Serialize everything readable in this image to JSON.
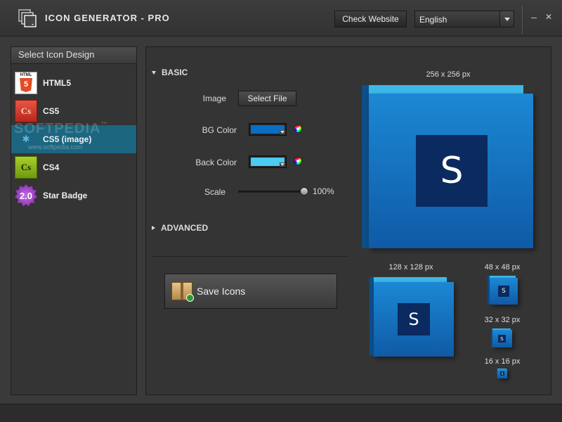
{
  "app": {
    "title": "ICON GENERATOR - PRO",
    "check_website_label": "Check Website",
    "language": "English",
    "minimize_glyph": "–",
    "close_glyph": "✕"
  },
  "sidebar": {
    "header": "Select Icon Design",
    "selected_index": 2,
    "items": [
      {
        "label": "HTML5",
        "icon": "html5-icon",
        "icon_text": "5",
        "icon_caption": "HTML"
      },
      {
        "label": "CS5",
        "icon": "cs5-icon",
        "icon_text": "Cs"
      },
      {
        "label": "CS5 (image)",
        "icon": "image-puzzle-icon",
        "icon_text": "✱"
      },
      {
        "label": "CS4",
        "icon": "cs4-icon",
        "icon_text": "Cs"
      },
      {
        "label": "Star Badge",
        "icon": "star-badge-icon",
        "icon_text": "2.0"
      }
    ],
    "watermark": "SOFTPEDIA",
    "watermark_tm": "™",
    "watermark_url": "www.softpedia.com"
  },
  "basic": {
    "title": "BASIC",
    "image_label": "Image",
    "select_file_label": "Select File",
    "bg_color_label": "BG Color",
    "bg_color": "#0a6ec2",
    "back_color_label": "Back Color",
    "back_color": "#4ccbf0",
    "scale_label": "Scale",
    "scale_value": "100%",
    "scale_fraction": 1.0
  },
  "advanced": {
    "title": "ADVANCED"
  },
  "save_icons_label": "Save Icons",
  "previews": [
    {
      "label": "256 x 256 px",
      "letter": "S"
    },
    {
      "label": "128 x 128 px",
      "letter": "S"
    },
    {
      "label": "48 x 48 px",
      "letter": "S"
    },
    {
      "label": "32 x 32 px",
      "letter": "S"
    },
    {
      "label": "16 x 16 px",
      "letter": "S"
    }
  ],
  "colors": {
    "selected_row": "#1c6680",
    "icon_top": "#3cb8e8",
    "icon_face": "#1477c8",
    "icon_inner": "#0a2a60"
  }
}
